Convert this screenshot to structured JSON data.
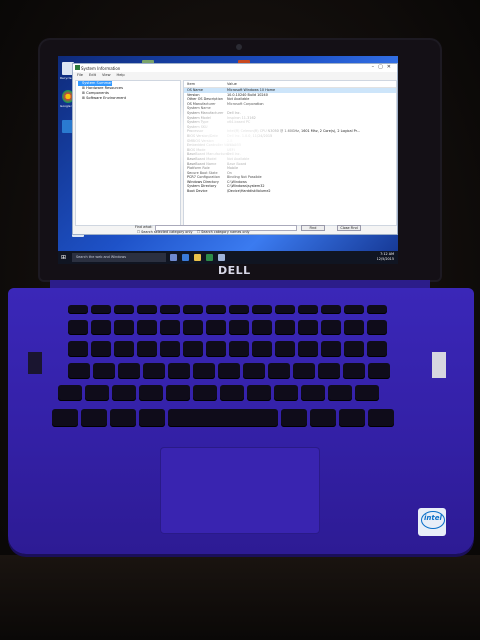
{
  "laptop": {
    "brand_logo": "DELL",
    "sticker": "intel"
  },
  "window": {
    "title": "System Information",
    "menus": [
      "File",
      "Edit",
      "View",
      "Help"
    ],
    "tree": [
      "System Summary",
      "Hardware Resources",
      "Components",
      "Software Environment"
    ],
    "detail_headers": [
      "Item",
      "Value"
    ],
    "detail_rows": [
      [
        "OS Name",
        "Microsoft Windows 10 Home"
      ],
      [
        "Version",
        "10.0.10240 Build 10240"
      ],
      [
        "Other OS Description",
        "Not Available"
      ],
      [
        "OS Manufacturer",
        "Microsoft Corporation"
      ],
      [
        "System Name",
        ""
      ],
      [
        "System Manufacturer",
        "Dell Inc."
      ],
      [
        "System Model",
        "Inspiron 11-3162"
      ],
      [
        "System Type",
        "x64-based PC"
      ],
      [
        "System SKU",
        ""
      ],
      [
        "Processor",
        "Intel(R) Celeron(R) CPU N3050 @ 1.60GHz, 1601 Mhz, 2 Core(s), 2 Logical Pr..."
      ],
      [
        "BIOS Version/Date",
        "Dell Inc. 1.0.0, 11/24/2015"
      ],
      [
        "SMBIOS Version",
        "2.8"
      ],
      [
        "Embedded Controller Version",
        "255.255"
      ],
      [
        "BIOS Mode",
        "UEFI"
      ],
      [
        "BaseBoard Manufacturer",
        "Dell Inc."
      ],
      [
        "BaseBoard Model",
        "Not Available"
      ],
      [
        "BaseBoard Name",
        "Base Board"
      ],
      [
        "Platform Role",
        "Mobile"
      ],
      [
        "Secure Boot State",
        "On"
      ],
      [
        "PCR7 Configuration",
        "Binding Not Possible"
      ],
      [
        "Windows Directory",
        "C:\\Windows"
      ],
      [
        "System Directory",
        "C:\\Windows\\system32"
      ],
      [
        "Boot Device",
        "\\Device\\HarddiskVolume2"
      ]
    ],
    "find_label": "Find what:",
    "find_button": "Find",
    "close_find_button": "Close Find",
    "search_selected": "Search selected category only",
    "search_names": "Search category names only"
  },
  "taskbar": {
    "search_placeholder": "Search the web and Windows",
    "clock_time": "7:12 AM",
    "clock_date": "12/5/2015"
  },
  "desktop_icons": [
    "Recycle Bin",
    "Google Chrome"
  ]
}
